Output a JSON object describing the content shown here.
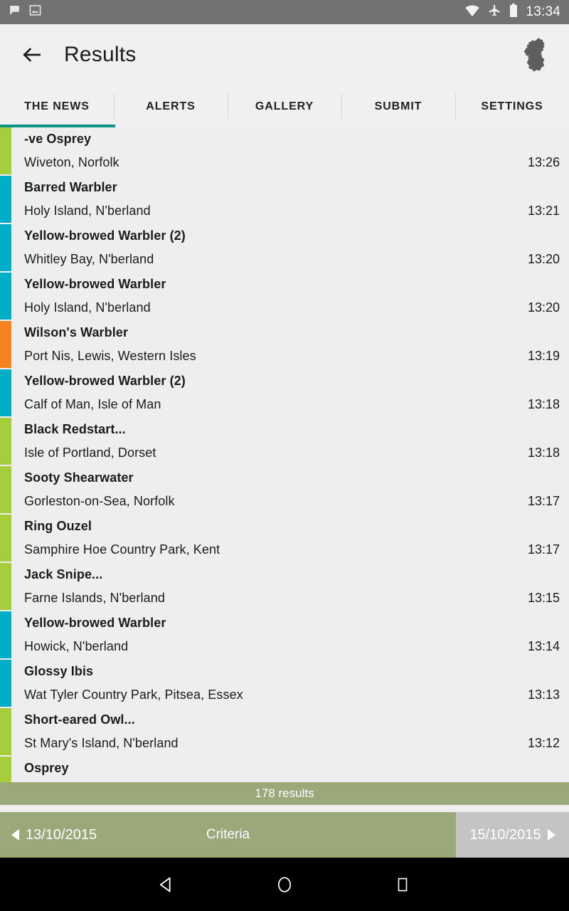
{
  "statusbar": {
    "time": "13:34",
    "left_icons": [
      "chat-bubble-icon",
      "screenshot-image-icon"
    ],
    "right_icons": [
      "wifi-icon",
      "airplane-mode-icon",
      "battery-icon"
    ]
  },
  "appbar": {
    "back_label": "back-arrow",
    "title": "Results",
    "logo": "uk-ireland-map-icon"
  },
  "tabs": [
    {
      "label": "THE NEWS",
      "active": true
    },
    {
      "label": "ALERTS",
      "active": false
    },
    {
      "label": "GALLERY",
      "active": false
    },
    {
      "label": "SUBMIT",
      "active": false
    },
    {
      "label": "SETTINGS",
      "active": false
    }
  ],
  "colors": {
    "accent_teal": "#0b9388",
    "bar_green": "#a5ce3a",
    "bar_cyan": "#00aec7",
    "bar_orange": "#f6821f",
    "footer_olive": "#9aa87a",
    "footer_grey": "#c4c4c4",
    "statusbar_grey": "#727272",
    "appbar_grey": "#f0f0f0"
  },
  "sightings": [
    {
      "name": "-ve Osprey",
      "location": "Wiveton, Norfolk",
      "time": "13:26",
      "color": "#a5ce3a"
    },
    {
      "name": "Barred Warbler",
      "location": "Holy Island, N'berland",
      "time": "13:21",
      "color": "#00aec7"
    },
    {
      "name": "Yellow-browed Warbler (2)",
      "location": "Whitley Bay, N'berland",
      "time": "13:20",
      "color": "#00aec7"
    },
    {
      "name": "Yellow-browed Warbler",
      "location": "Holy Island, N'berland",
      "time": "13:20",
      "color": "#00aec7"
    },
    {
      "name": "Wilson's Warbler",
      "location": "Port Nis, Lewis, Western Isles",
      "time": "13:19",
      "color": "#f6821f"
    },
    {
      "name": "Yellow-browed Warbler (2)",
      "location": "Calf of Man, Isle of Man",
      "time": "13:18",
      "color": "#00aec7"
    },
    {
      "name": "Black Redstart...",
      "location": "Isle of Portland, Dorset",
      "time": "13:18",
      "color": "#a5ce3a"
    },
    {
      "name": "Sooty Shearwater",
      "location": "Gorleston-on-Sea, Norfolk",
      "time": "13:17",
      "color": "#a5ce3a"
    },
    {
      "name": "Ring Ouzel",
      "location": "Samphire Hoe Country Park, Kent",
      "time": "13:17",
      "color": "#a5ce3a"
    },
    {
      "name": "Jack Snipe...",
      "location": "Farne Islands, N'berland",
      "time": "13:15",
      "color": "#a5ce3a"
    },
    {
      "name": "Yellow-browed Warbler",
      "location": "Howick, N'berland",
      "time": "13:14",
      "color": "#00aec7"
    },
    {
      "name": "Glossy Ibis",
      "location": "Wat Tyler Country Park, Pitsea, Essex",
      "time": "13:13",
      "color": "#00aec7"
    },
    {
      "name": "Short-eared Owl...",
      "location": "St Mary's Island, N'berland",
      "time": "13:12",
      "color": "#a5ce3a"
    },
    {
      "name": "Osprey",
      "location": "",
      "time": "",
      "color": "#a5ce3a"
    }
  ],
  "footer": {
    "results_count": "178 results",
    "prev_date": "13/10/2015",
    "criteria_label": "Criteria",
    "next_date": "15/10/2015"
  },
  "sysnav": {
    "back": "back-triangle-icon",
    "home": "home-circle-icon",
    "recents": "recents-square-icon"
  }
}
